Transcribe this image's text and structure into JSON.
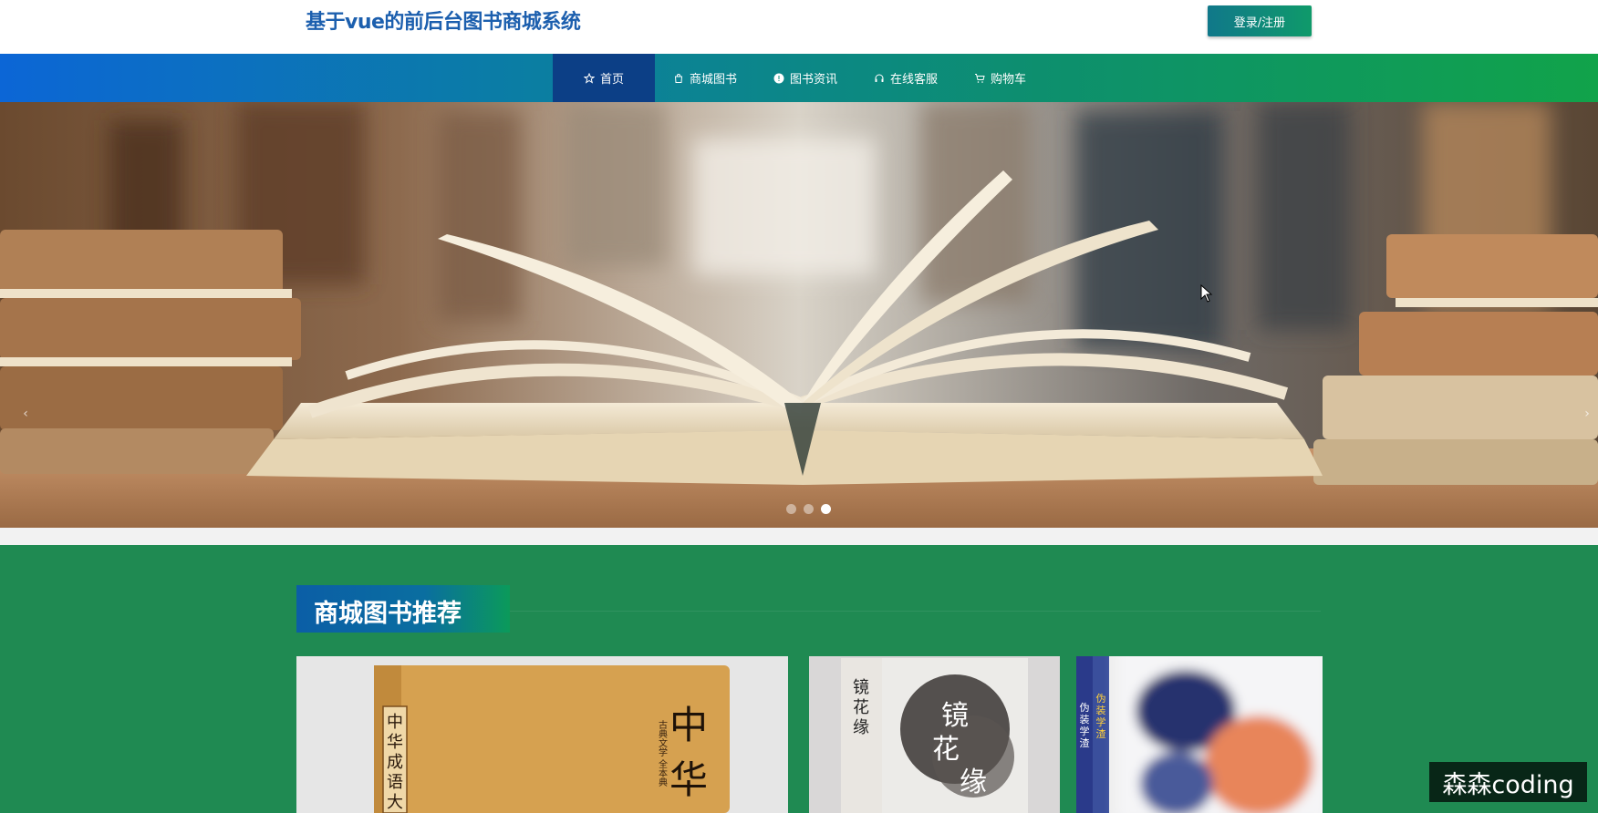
{
  "header": {
    "site_title": "基于vue的前后台图书商城系统",
    "login_label": "登录/注册"
  },
  "nav": {
    "items": [
      {
        "label": "首页",
        "icon": "star-icon",
        "active": true
      },
      {
        "label": "商城图书",
        "icon": "shopping-bag-icon",
        "active": false
      },
      {
        "label": "图书资讯",
        "icon": "info-icon",
        "active": false
      },
      {
        "label": "在线客服",
        "icon": "headset-icon",
        "active": false
      },
      {
        "label": "购物车",
        "icon": "cart-icon",
        "active": false
      }
    ]
  },
  "banner": {
    "slide_count": 3,
    "active_slide": 3
  },
  "recommend": {
    "title": "商城图书推荐",
    "books": [
      {
        "cover_text_1": "中华成语大",
        "cover_text_2": "古典文学 全本典",
        "cover_text_3": "中华"
      },
      {
        "cover_text_1": "镜花缘",
        "cover_text_2": "镜花缘"
      },
      {
        "cover_text_1": "伪装学渣",
        "cover_text_2": "伪装学渣"
      }
    ]
  },
  "watermark": "森森coding",
  "colors": {
    "brand_blue": "#1c5fae",
    "nav_active": "#0c3f86",
    "section_green": "#1f8a52"
  }
}
